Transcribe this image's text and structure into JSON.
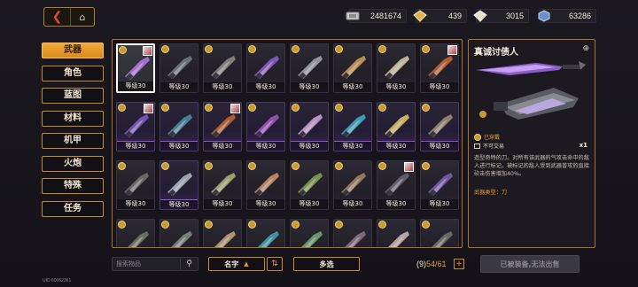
{
  "nav": {
    "back_icon": "back-arrow-icon",
    "home_icon": "home-icon"
  },
  "currencies": [
    {
      "icon": "credits-icon",
      "value": "2481674"
    },
    {
      "icon": "gold-crystal-icon",
      "value": "439"
    },
    {
      "icon": "white-crystal-icon",
      "value": "3015"
    },
    {
      "icon": "blue-cube-icon",
      "value": "63286"
    }
  ],
  "categories": [
    "武器",
    "角色",
    "蓝图",
    "材料",
    "机甲",
    "火炮",
    "特殊",
    "任务"
  ],
  "active_category": "武器",
  "grid": {
    "level_label": "等级30",
    "items": [
      {
        "rarity": "grey",
        "badge": true,
        "portrait": true,
        "selected": true,
        "weapon_color": "#b070e0"
      },
      {
        "rarity": "grey",
        "badge": true,
        "portrait": false,
        "weapon_color": "#707880"
      },
      {
        "rarity": "grey",
        "badge": true,
        "portrait": false,
        "weapon_color": "#8a8a80"
      },
      {
        "rarity": "grey",
        "badge": true,
        "portrait": false,
        "weapon_color": "#8a5cc8"
      },
      {
        "rarity": "grey",
        "badge": true,
        "portrait": false,
        "weapon_color": "#a0a0a8"
      },
      {
        "rarity": "grey",
        "badge": true,
        "portrait": false,
        "weapon_color": "#c89a50"
      },
      {
        "rarity": "grey",
        "badge": true,
        "portrait": false,
        "weapon_color": "#d0c8a0"
      },
      {
        "rarity": "grey",
        "badge": true,
        "portrait": true,
        "weapon_color": "#c86030"
      },
      {
        "rarity": "purple",
        "badge": true,
        "portrait": true,
        "weapon_color": "#7a5ac0"
      },
      {
        "rarity": "purple",
        "badge": true,
        "portrait": false,
        "weapon_color": "#4a8a9a"
      },
      {
        "rarity": "purple",
        "badge": true,
        "portrait": true,
        "weapon_color": "#c06030"
      },
      {
        "rarity": "purple",
        "badge": true,
        "portrait": false,
        "weapon_color": "#a050c0"
      },
      {
        "rarity": "purple",
        "badge": true,
        "portrait": false,
        "weapon_color": "#c8a0d0"
      },
      {
        "rarity": "purple",
        "badge": true,
        "portrait": false,
        "weapon_color": "#40a8c0"
      },
      {
        "rarity": "purple",
        "badge": true,
        "portrait": false,
        "weapon_color": "#d8c060"
      },
      {
        "rarity": "purple",
        "badge": true,
        "portrait": false,
        "weapon_color": "#9a8a70"
      },
      {
        "rarity": "grey",
        "badge": true,
        "portrait": false,
        "weapon_color": "#707070"
      },
      {
        "rarity": "purple",
        "badge": true,
        "portrait": false,
        "weapon_color": "#a8b0c0"
      },
      {
        "rarity": "grey",
        "badge": true,
        "portrait": false,
        "weapon_color": "#a8b070"
      },
      {
        "rarity": "grey",
        "badge": true,
        "portrait": false,
        "weapon_color": "#c89060"
      },
      {
        "rarity": "grey",
        "badge": true,
        "portrait": false,
        "weapon_color": "#80a050"
      },
      {
        "rarity": "grey",
        "badge": true,
        "portrait": false,
        "weapon_color": "#a08060"
      },
      {
        "rarity": "grey",
        "badge": true,
        "portrait": true,
        "weapon_color": "#6a6070"
      },
      {
        "rarity": "grey",
        "badge": true,
        "portrait": false,
        "weapon_color": "#7a5ab0"
      },
      {
        "rarity": "grey",
        "badge": true,
        "portrait": false,
        "weapon_color": "#707860"
      },
      {
        "rarity": "grey",
        "badge": true,
        "portrait": false,
        "weapon_color": "#808880"
      },
      {
        "rarity": "grey",
        "badge": true,
        "portrait": false,
        "weapon_color": "#c0a080"
      },
      {
        "rarity": "grey",
        "badge": true,
        "portrait": false,
        "weapon_color": "#40a0b0"
      },
      {
        "rarity": "grey",
        "badge": true,
        "portrait": false,
        "weapon_color": "#70a070"
      },
      {
        "rarity": "grey",
        "badge": true,
        "portrait": false,
        "weapon_color": "#8a7080"
      },
      {
        "rarity": "grey",
        "badge": true,
        "portrait": false,
        "weapon_color": "#c8b0b0"
      },
      {
        "rarity": "grey",
        "badge": true,
        "portrait": false,
        "weapon_color": "#707068"
      }
    ]
  },
  "detail": {
    "name": "真诚讨债人",
    "zoom_icon": "zoom-icon",
    "equipped_label": "已穿戴",
    "trade_label": "不可交易",
    "quantity": "x1",
    "description": "造型奇特的刀。对所有该武器的气攻击命中的敌人进行标记，被标记的敌人受到武器普攻的直接砍击伤害增加40%。",
    "weapon_type": "武器类型：刀"
  },
  "bottom": {
    "search_placeholder": "搜索物品",
    "sort_label": "名字",
    "multi_select_label": "多选",
    "capacity_prefix": "(9)",
    "capacity_value": "54/61",
    "sell_label": "已被装备,无法出售",
    "uid": "UID 60062361"
  }
}
